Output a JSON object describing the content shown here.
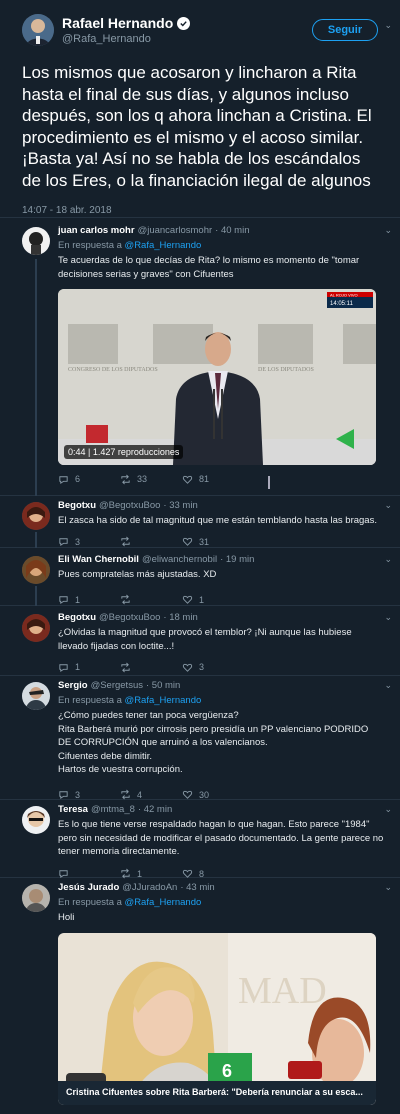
{
  "main_tweet": {
    "author": "Rafael Hernando",
    "handle": "@Rafa_Hernando",
    "follow_label": "Seguir",
    "text": "Los mismos que acosaron y lincharon a Rita hasta el final de sus días,  y algunos incluso después, son los q ahora linchan a Cristina. El procedimiento es el mismo y el acoso similar. ¡Basta ya! Así no se habla de los escándalos de los Eres, o la financiación ilegal de algunos",
    "time": "14:07 - 18 abr. 2018"
  },
  "replies": [
    {
      "name": "juan carlos mohr",
      "handle": "@juancarlosmohr",
      "time": "· 40 min",
      "replying_prefix": "En respuesta a",
      "replying_to": "@Rafa_Hernando",
      "text": "Te acuerdas de lo que decías de Rita? lo mismo es momento de \"tomar decisiones serias y graves\" con Cifuentes",
      "video_duration": "0:44",
      "video_views": "1.427 reproducciones",
      "video_channel_tag": "AL ROJO VIVO",
      "video_clock": "14:05:11",
      "replies_count": "6",
      "retweets": "33",
      "likes": "81"
    },
    {
      "name": "Begotxu",
      "handle": "@BegotxuBoo",
      "time": "· 33 min",
      "text": "El zasca ha sido de tal magnitud que me están temblando hasta las bragas.",
      "replies_count": "3",
      "retweets": "",
      "likes": "31"
    },
    {
      "name": "Eli Wan Chernobil",
      "handle": "@eliwanchernobil",
      "time": "· 19 min",
      "text": "Pues compratelas más ajustadas. XD",
      "replies_count": "1",
      "retweets": "",
      "likes": "1"
    },
    {
      "name": "Begotxu",
      "handle": "@BegotxuBoo",
      "time": "· 18 min",
      "text": "¿Olvidas la magnitud que provocó el temblor? ¡Ni aunque las hubiese llevado fijadas con loctite...!",
      "replies_count": "1",
      "retweets": "",
      "likes": "3"
    },
    {
      "name": "Sergio",
      "handle": "@Sergetsus",
      "time": "· 50 min",
      "replying_prefix": "En respuesta a",
      "replying_to": "@Rafa_Hernando",
      "text_lines": [
        "¿Cómo puedes tener tan poca vergüenza?",
        "Rita Barberá murió por cirrosis pero presidía un  PP valenciano PODRIDO DE CORRUPCIÓN que arruinó a los valencianos.",
        "Cifuentes debe dimitir.",
        "Hartos de vuestra corrupción."
      ],
      "replies_count": "3",
      "retweets": "4",
      "likes": "30"
    },
    {
      "name": "Teresa",
      "handle": "@mtma_8",
      "time": "· 42 min",
      "text": "Es lo que tiene verse respaldado hagan lo que hagan. Esto parece \"1984\" pero sin necesidad de modificar el pasado documentado. La gente parece no tener memoria directamente.",
      "replies_count": "",
      "retweets": "1",
      "likes": "8"
    },
    {
      "name": "Jesús Jurado",
      "handle": "@JJuradoAn",
      "time": "· 43 min",
      "replying_prefix": "En respuesta a",
      "replying_to": "@Rafa_Hernando",
      "text": "Holi",
      "card_title": "Cristina Cifuentes sobre Rita Barberá: \"Debería renunciar a su esca...",
      "card_logo": "laSexta"
    }
  ],
  "colors": {
    "background": "#15202b",
    "accent": "#1da1f2",
    "muted": "#8899a6",
    "like": "#e0245e"
  },
  "icons": [
    "verified-icon",
    "reply-icon",
    "retweet-icon",
    "like-icon",
    "chevron-down-icon",
    "cursor-icon"
  ]
}
